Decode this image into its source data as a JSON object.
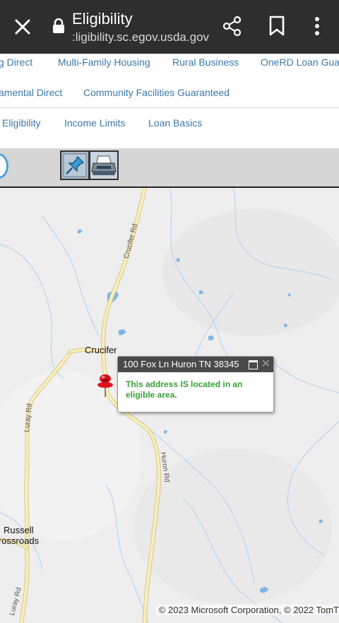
{
  "browser": {
    "title": "Eligibility",
    "url": ":ligibility.sc.egov.usda.gov"
  },
  "nav": {
    "row1": [
      "g Direct",
      "Multi-Family Housing",
      "Rural Business",
      "OneRD Loan Guara"
    ],
    "row2": [
      "amental Direct",
      "Community Facilities Guaranteed"
    ],
    "row3": [
      "Eligibility",
      "Income Limits",
      "Loan Basics"
    ]
  },
  "map": {
    "labels": {
      "town_crucifer": "Crucifer",
      "town_russell_1": "Russell",
      "town_russell_2": "rossroads",
      "road_crucifer": "Crucifer Rd",
      "road_luray": "Luray Rd",
      "road_huron": "Huron Rd",
      "road_luray_bottom": "Luray Rd"
    },
    "popup": {
      "address": "100 Fox Ln Huron TN 38345",
      "message": "This address IS located in an eligible area."
    },
    "copyright": "© 2023 Microsoft Corporation, © 2022 TomT"
  },
  "colors": {
    "link": "#3c78a8",
    "eligible_text": "#3aa03a",
    "road": "#f3e3a8",
    "water": "#7fb5e6"
  }
}
